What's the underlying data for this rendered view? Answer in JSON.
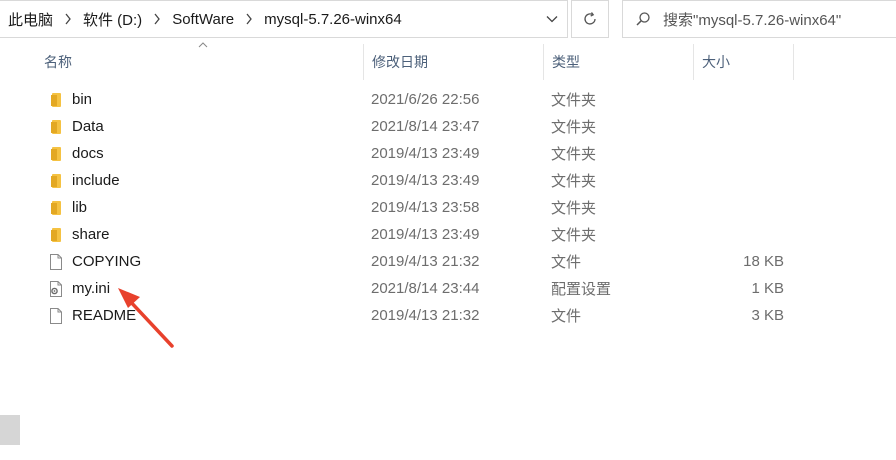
{
  "breadcrumb": {
    "items": [
      "此电脑",
      "软件 (D:)",
      "SoftWare",
      "mysql-5.7.26-winx64"
    ]
  },
  "search": {
    "placeholder": "搜索\"mysql-5.7.26-winx64\""
  },
  "columns": {
    "name": "名称",
    "date": "修改日期",
    "type": "类型",
    "size": "大小"
  },
  "files": [
    {
      "name": "bin",
      "date": "2021/6/26 22:56",
      "type": "文件夹",
      "size": "",
      "icon": "folder-icon"
    },
    {
      "name": "Data",
      "date": "2021/8/14 23:47",
      "type": "文件夹",
      "size": "",
      "icon": "folder-icon"
    },
    {
      "name": "docs",
      "date": "2019/4/13 23:49",
      "type": "文件夹",
      "size": "",
      "icon": "folder-icon"
    },
    {
      "name": "include",
      "date": "2019/4/13 23:49",
      "type": "文件夹",
      "size": "",
      "icon": "folder-icon"
    },
    {
      "name": "lib",
      "date": "2019/4/13 23:58",
      "type": "文件夹",
      "size": "",
      "icon": "folder-icon"
    },
    {
      "name": "share",
      "date": "2019/4/13 23:49",
      "type": "文件夹",
      "size": "",
      "icon": "folder-icon"
    },
    {
      "name": "COPYING",
      "date": "2019/4/13 21:32",
      "type": "文件",
      "size": "18 KB",
      "icon": "file-icon"
    },
    {
      "name": "my.ini",
      "date": "2021/8/14 23:44",
      "type": "配置设置",
      "size": "1 KB",
      "icon": "config-file-icon"
    },
    {
      "name": "README",
      "date": "2019/4/13 21:32",
      "type": "文件",
      "size": "3 KB",
      "icon": "file-icon"
    }
  ],
  "colors": {
    "folder": "#f5c242",
    "header_text": "#4c607a",
    "arrow": "#e8412c"
  }
}
